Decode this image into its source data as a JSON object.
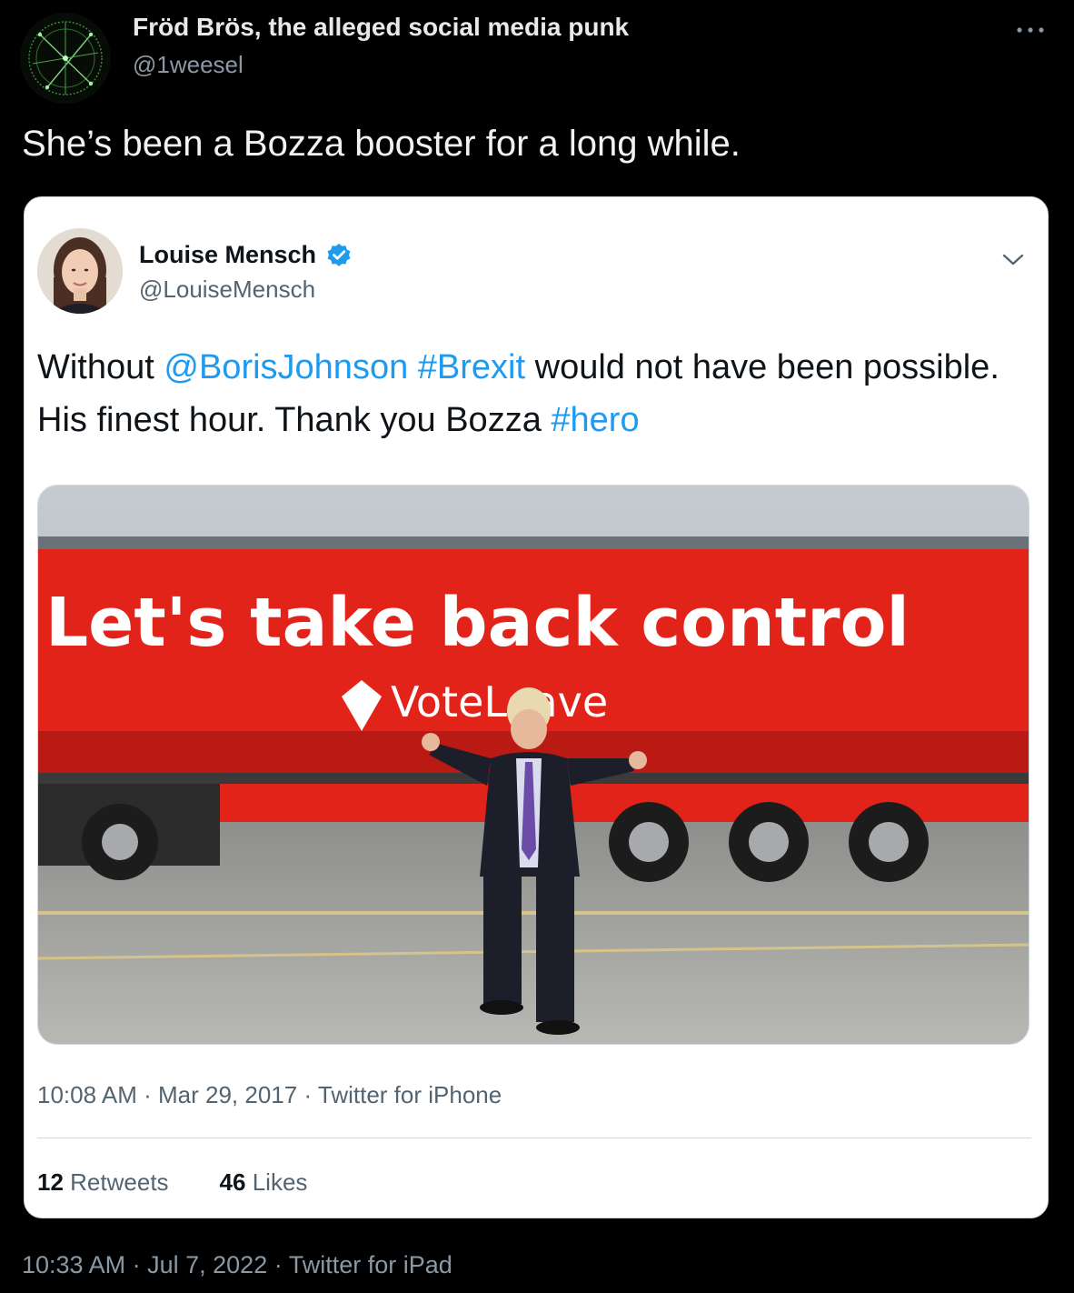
{
  "tweet": {
    "author_name": "Fröd Brös, the alleged social media punk",
    "author_handle": "@1weesel",
    "text": "She’s been a Bozza booster for a long while.",
    "time": "10:33 AM",
    "date": "Jul 7, 2022",
    "source": "Twitter for iPad",
    "more_icon": "more-horizontal-icon"
  },
  "quoted": {
    "author_name": "Louise Mensch",
    "author_handle": "@LouiseMensch",
    "verified_icon": "verified-badge-icon",
    "chevron_icon": "chevron-down-icon",
    "text_parts": {
      "p1": "Without ",
      "mention": "@BorisJohnson",
      "p2": " ",
      "hashtag1": "#Brexit",
      "p3": " would not have been possible. His finest hour. Thank you Bozza ",
      "hashtag2": "#hero"
    },
    "photo": {
      "banner_line1": "Let's take back control",
      "banner_line2": "VoteLeave"
    },
    "time": "10:08 AM",
    "date": "Mar 29, 2017",
    "source": "Twitter for iPhone",
    "retweets_count": "12",
    "retweets_label": "Retweets",
    "likes_count": "46",
    "likes_label": "Likes"
  },
  "separator": "·",
  "colors": {
    "background": "#000000",
    "link": "#1d9bf0",
    "verified": "#1d9bf0",
    "banner_red": "#e2231a"
  }
}
